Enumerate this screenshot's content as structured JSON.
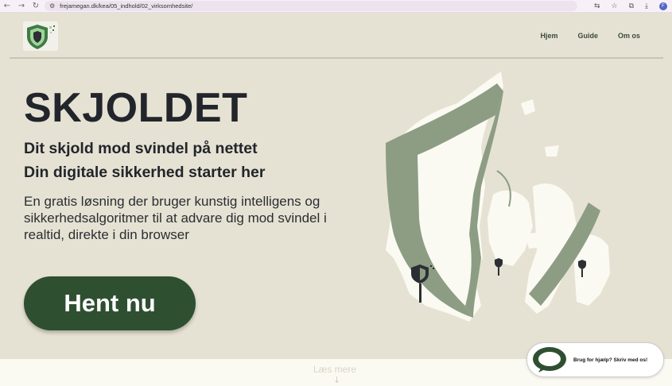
{
  "browser": {
    "url": "frejamegan.dk/kea/05_indhold/02_virksomhedsite/",
    "profile_initial": "F"
  },
  "nav": {
    "items": [
      {
        "label": "Hjem"
      },
      {
        "label": "Guide"
      },
      {
        "label": "Om os"
      }
    ]
  },
  "hero": {
    "title": "SKJOLDET",
    "subtitle_1": "Dit skjold mod svindel på nettet",
    "subtitle_2": "Din digitale sikkerhed starter her",
    "description": "En gratis løsning der bruger kunstig intelligens og sikkerhedsalgoritmer til at advare dig mod svindel i realtid, direkte i din browser",
    "cta_label": "Hent nu"
  },
  "footer": {
    "read_more": "Læs mere"
  },
  "chat": {
    "label": "Brug for hjælp? Skriv med os!"
  },
  "colors": {
    "background": "#e6e2d3",
    "brand_green": "#2f4f31",
    "map_green": "#8c9d84",
    "map_land": "#fbfaf2"
  }
}
